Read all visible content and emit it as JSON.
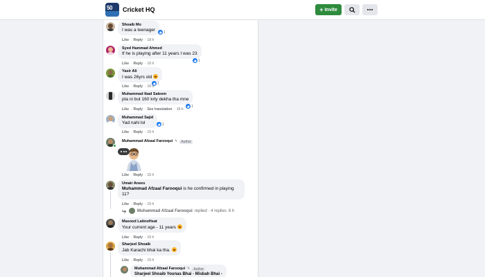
{
  "header": {
    "group_name": "Cricket HQ",
    "group_logo_text": "50",
    "invite_label": "Invite",
    "search_icon": "search-icon",
    "more_icon": "more-icon"
  },
  "comments": [
    {
      "author": "Shoaib Mo",
      "text": "I was a teenager",
      "reactions": "1",
      "reaction_type": "like",
      "like": "Like",
      "reply": "Reply",
      "time": "18 h"
    },
    {
      "author": "Syed Hammad Ahmed",
      "text": "If he is playing after 11 years I was 23",
      "reactions": "1",
      "reaction_type": "like",
      "like": "Like",
      "reply": "Reply",
      "time": "16 h"
    },
    {
      "author": "Yasir Ali",
      "text": "I was 26yrs old",
      "text_emoji": "😄",
      "reactions": "1",
      "reaction_type": "like",
      "like": "Like",
      "reply": "Reply",
      "time": "16 h"
    },
    {
      "author": "Muhammad Ibad Saleem",
      "text": "pta ni but 160 krty dekha tha mne",
      "reactions": "1",
      "reaction_type": "like",
      "like": "Like",
      "reply": "Reply",
      "see_translation": "See translation",
      "time": "16 h"
    },
    {
      "author": "Muhammad Sajid",
      "text": "Yad nahi lol",
      "reactions": "1",
      "reaction_type": "like",
      "like": "Like",
      "reply": "Reply",
      "time": "15 h"
    },
    {
      "author": "Muhammad Afzaal Farooqui",
      "author_badge": "Author",
      "text": "",
      "like": "Like",
      "reply": "Reply",
      "time": "15 h"
    },
    {
      "author": "Umair Anees",
      "mention": "Muhammad Afzaal Farooqui",
      "text": "is he confirmed in playing",
      "text_line2": "11?",
      "like": "Like",
      "reply": "Reply",
      "time": "15 h"
    },
    {
      "author": "Masood LatinoHeat",
      "text": "Your current age - 11 years",
      "like": "Like",
      "reply": "Reply",
      "time": "15 h"
    },
    {
      "author": "Sharjeel Shoaib",
      "text": "Jab Karachi bhai ka tha.",
      "like": "Like",
      "reply": "Reply",
      "time": "15 h"
    }
  ],
  "replies_summary": {
    "name": "Muhammad Afzaal Farooqui",
    "text": "replied · 4 replies",
    "time": "6 h"
  },
  "nested_reply": {
    "author": "Muhammad Afzaal Farooqui",
    "author_badge": "Author",
    "text": "Sharjeel Shoaib Younas Bhai - Misbah Bhai -"
  },
  "colors": {
    "like_blue": "#1877f2",
    "invite_green": "#2e8b3d"
  }
}
